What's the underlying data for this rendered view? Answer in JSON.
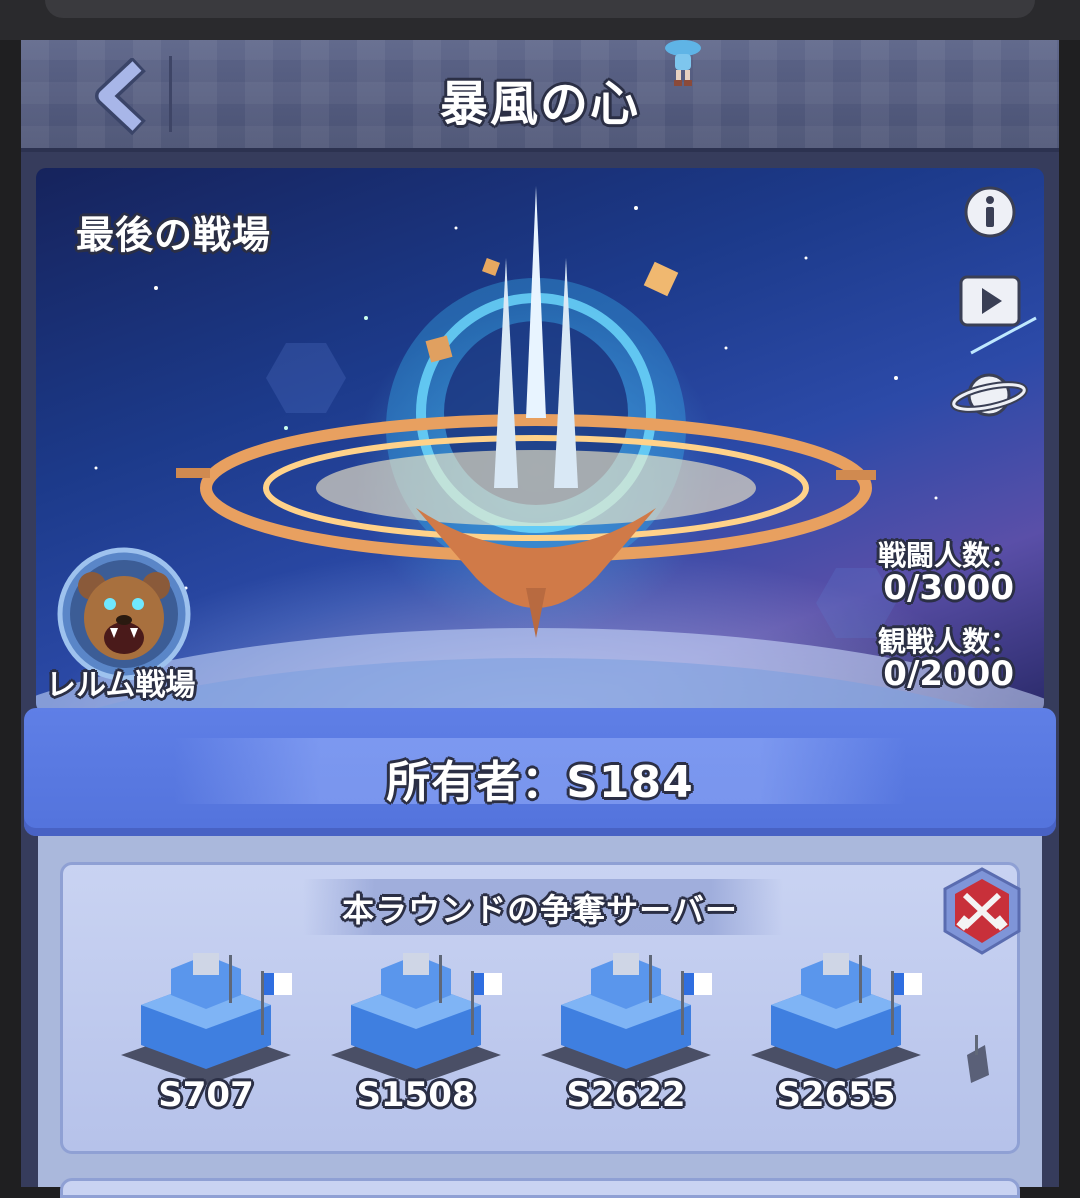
{
  "header": {
    "title": "暴風の心"
  },
  "banner": {
    "title": "最後の戦場",
    "stats": [
      {
        "label": "戦闘人数：",
        "value": "0/3000"
      },
      {
        "label": "観戦人数：",
        "value": "0/2000"
      }
    ],
    "realm_label": "レルム戦場"
  },
  "owner": {
    "text": "所有者：S184"
  },
  "servers": {
    "title": "本ラウンドの争奪サーバー",
    "items": [
      "S707",
      "S1508",
      "S2622",
      "S2655"
    ]
  },
  "colors": {
    "accent": "#5b7be3",
    "header": "#4f5779",
    "panel": "#aab8dc"
  }
}
